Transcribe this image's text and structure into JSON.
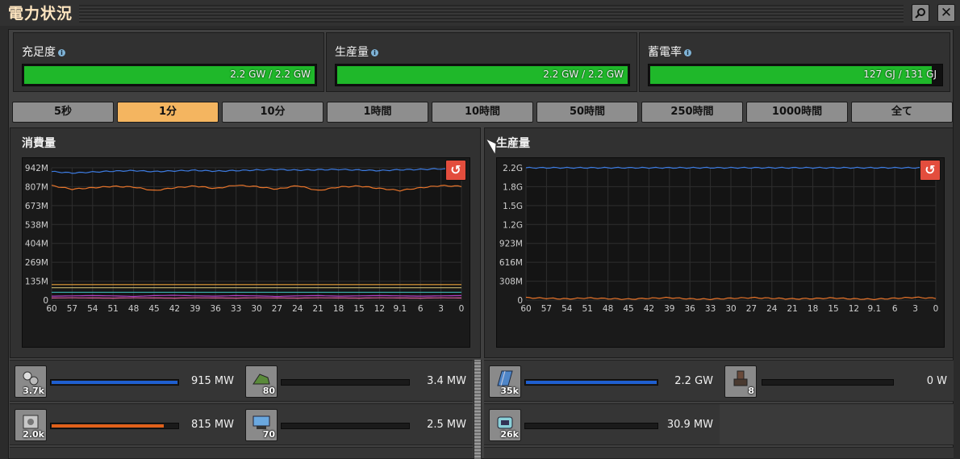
{
  "window": {
    "title": "電力状況",
    "search_icon": "search-icon",
    "close_icon": "close-icon"
  },
  "stats": [
    {
      "label": "充足度",
      "value_text": "2.2 GW / 2.2 GW",
      "fill_fraction": 1.0
    },
    {
      "label": "生産量",
      "value_text": "2.2 GW / 2.2 GW",
      "fill_fraction": 1.0
    },
    {
      "label": "蓄電率",
      "value_text": "127 GJ / 131 GJ",
      "fill_fraction": 0.97
    }
  ],
  "time_buttons": [
    "5秒",
    "1分",
    "10分",
    "1時間",
    "10時間",
    "50時間",
    "250時間",
    "1000時間",
    "全て"
  ],
  "active_time_button": 1,
  "colors": {
    "accent": "#f4b560",
    "bar_green": "#1fb82a",
    "series_blue": "#3d7be0",
    "series_orange": "#e8742a",
    "reset_red": "#e34d3d"
  },
  "consumption": {
    "title": "消費量",
    "chart_data": {
      "type": "line",
      "x": [
        60,
        57,
        54,
        51,
        48,
        45,
        42,
        39,
        36,
        33,
        30,
        27,
        24,
        21,
        18,
        15,
        12,
        9.1,
        6,
        3,
        0
      ],
      "x_tick_labels": [
        "60",
        "57",
        "54",
        "51",
        "48",
        "45",
        "42",
        "39",
        "36",
        "33",
        "30",
        "27",
        "24",
        "21",
        "18",
        "15",
        "12",
        "9.1",
        "6",
        "3",
        "0"
      ],
      "y_tick_labels": [
        "942M",
        "807M",
        "673M",
        "538M",
        "404M",
        "269M",
        "135M",
        "0"
      ],
      "ylim": [
        0,
        942
      ],
      "grid": true,
      "series": [
        {
          "color": "#3d7be0",
          "values": [
            915,
            905,
            912,
            918,
            922,
            915,
            920,
            924,
            918,
            922,
            926,
            930,
            925,
            928,
            930,
            926,
            922,
            928,
            930,
            935,
            920
          ]
        },
        {
          "color": "#e8742a",
          "values": [
            815,
            790,
            800,
            810,
            805,
            780,
            800,
            812,
            795,
            818,
            808,
            790,
            815,
            780,
            805,
            812,
            795,
            780,
            800,
            815,
            810
          ]
        },
        {
          "color": "#e6a03a",
          "values": [
            110,
            110,
            110,
            110,
            110,
            110,
            110,
            110,
            110,
            110,
            110,
            110,
            110,
            110,
            110,
            110,
            110,
            110,
            110,
            110,
            110
          ]
        },
        {
          "color": "#c8b46e",
          "values": [
            88,
            88,
            88,
            88,
            88,
            88,
            88,
            88,
            88,
            88,
            88,
            88,
            88,
            88,
            88,
            88,
            88,
            88,
            88,
            88,
            88
          ]
        },
        {
          "color": "#3aa6a6",
          "values": [
            55,
            55,
            55,
            55,
            55,
            55,
            55,
            55,
            55,
            55,
            55,
            55,
            55,
            55,
            55,
            55,
            55,
            55,
            55,
            55,
            55
          ]
        },
        {
          "color": "#b040c8",
          "values": [
            28,
            30,
            32,
            30,
            26,
            32,
            34,
            30,
            28,
            32,
            30,
            26,
            30,
            32,
            28,
            30,
            32,
            30,
            28,
            30,
            32
          ]
        },
        {
          "color": "#e060a0",
          "values": [
            15,
            16,
            15,
            14,
            16,
            15,
            14,
            16,
            15,
            14,
            16,
            15,
            14,
            16,
            15,
            14,
            16,
            15,
            14,
            16,
            15
          ]
        }
      ]
    }
  },
  "production": {
    "title": "生産量",
    "chart_data": {
      "type": "line",
      "x": [
        60,
        57,
        54,
        51,
        48,
        45,
        42,
        39,
        36,
        33,
        30,
        27,
        24,
        21,
        18,
        15,
        12,
        9.1,
        6,
        3,
        0
      ],
      "x_tick_labels": [
        "60",
        "57",
        "54",
        "51",
        "48",
        "45",
        "42",
        "39",
        "36",
        "33",
        "30",
        "27",
        "24",
        "21",
        "18",
        "15",
        "12",
        "9.1",
        "6",
        "3",
        "0"
      ],
      "y_tick_labels": [
        "2.2G",
        "1.8G",
        "1.5G",
        "1.2G",
        "923M",
        "616M",
        "308M",
        "0"
      ],
      "ylim": [
        0,
        2200
      ],
      "grid": true,
      "series": [
        {
          "color": "#3d7be0",
          "values": [
            2200,
            2200,
            2200,
            2200,
            2200,
            2200,
            2200,
            2200,
            2200,
            2200,
            2200,
            2200,
            2200,
            2200,
            2200,
            2200,
            2200,
            2200,
            2200,
            2200,
            2200
          ]
        },
        {
          "color": "#e8742a",
          "values": [
            40,
            30,
            20,
            35,
            25,
            15,
            30,
            40,
            20,
            15,
            30,
            40,
            30,
            20,
            25,
            35,
            20,
            15,
            30,
            45,
            30
          ]
        }
      ]
    }
  },
  "consumers": [
    {
      "icon": "gear-assembly-icon",
      "count": "3.7k",
      "value": "915 MW",
      "fraction": 1.0,
      "color": "#1f5fd0"
    },
    {
      "icon": "pumpjack-icon",
      "count": "80",
      "value": "3.4 MW",
      "fraction": 0.0,
      "color": "#1f5fd0"
    },
    {
      "icon": "machine-icon",
      "count": "2.0k",
      "value": "815 MW",
      "fraction": 0.89,
      "color": "#e0601a"
    },
    {
      "icon": "beacon-icon",
      "count": "70",
      "value": "2.5 MW",
      "fraction": 0.0,
      "color": "#e0601a"
    }
  ],
  "producers": [
    {
      "icon": "solar-panel-icon",
      "count": "35k",
      "value": "2.2 GW",
      "fraction": 1.0,
      "color": "#1f5fd0"
    },
    {
      "icon": "steam-engine-icon",
      "count": "8",
      "value": "0 W",
      "fraction": 0.0,
      "color": "#1f5fd0"
    },
    {
      "icon": "accumulator-icon",
      "count": "26k",
      "value": "30.9 MW",
      "fraction": 0.01,
      "color": "#e0601a"
    }
  ]
}
